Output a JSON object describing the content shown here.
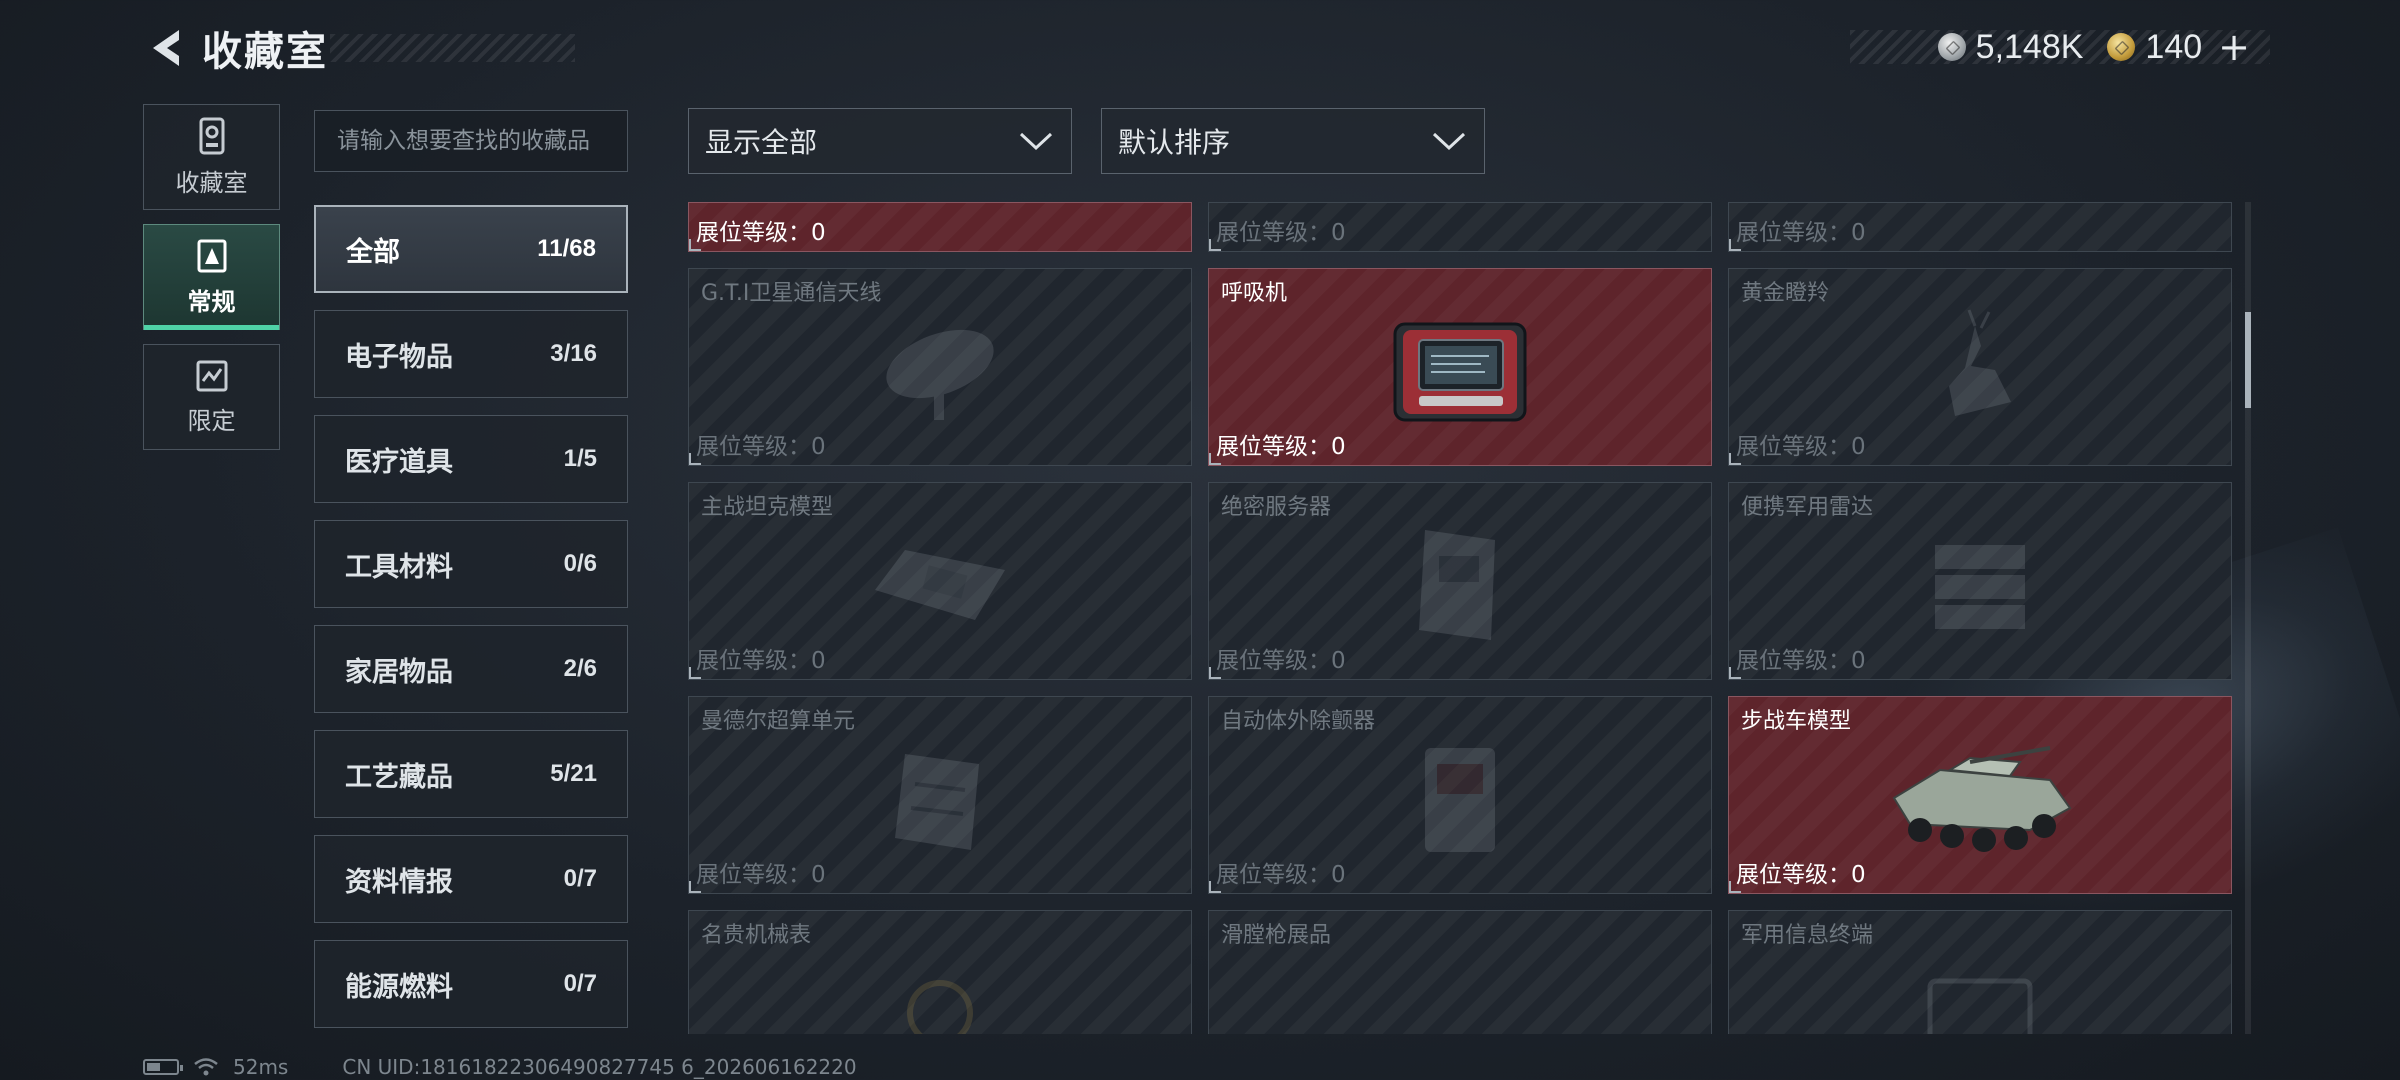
{
  "header": {
    "title": "收藏室",
    "currency": [
      {
        "icon": "silver-coin-icon",
        "value": "5,148K"
      },
      {
        "icon": "gold-coin-icon",
        "value": "140"
      }
    ],
    "plus_label": "+"
  },
  "mode_nav": [
    {
      "label": "收藏室",
      "icon": "collection-room-icon",
      "active": false
    },
    {
      "label": "常规",
      "icon": "regular-icon",
      "active": true
    },
    {
      "label": "限定",
      "icon": "limited-icon",
      "active": false
    }
  ],
  "search": {
    "placeholder": "请输入想要查找的收藏品"
  },
  "categories": [
    {
      "label": "全部",
      "count": "11/68",
      "active": true
    },
    {
      "label": "电子物品",
      "count": "3/16"
    },
    {
      "label": "医疗道具",
      "count": "1/5"
    },
    {
      "label": "工具材料",
      "count": "0/6"
    },
    {
      "label": "家居物品",
      "count": "2/6"
    },
    {
      "label": "工艺藏品",
      "count": "5/21"
    },
    {
      "label": "资料情报",
      "count": "0/7"
    },
    {
      "label": "能源燃料",
      "count": "0/7"
    }
  ],
  "filters": {
    "show_label": "显示全部",
    "sort_label": "默认排序"
  },
  "items": [
    {
      "name": "",
      "level": "展位等级：0",
      "owned": true,
      "icon": "item-icon"
    },
    {
      "name": "",
      "level": "展位等级：0",
      "owned": false,
      "icon": "item-icon"
    },
    {
      "name": "",
      "level": "展位等级：0",
      "owned": false,
      "icon": "item-icon"
    },
    {
      "name": "G.T.I卫星通信天线",
      "level": "展位等级：0",
      "owned": false,
      "icon": "satellite-dish-icon"
    },
    {
      "name": "呼吸机",
      "level": "展位等级：0",
      "owned": true,
      "icon": "ventilator-icon"
    },
    {
      "name": "黄金瞪羚",
      "level": "展位等级：0",
      "owned": false,
      "icon": "gazelle-statue-icon"
    },
    {
      "name": "主战坦克模型",
      "level": "展位等级：0",
      "owned": false,
      "icon": "tank-model-icon"
    },
    {
      "name": "绝密服务器",
      "level": "展位等级：0",
      "owned": false,
      "icon": "server-icon"
    },
    {
      "name": "便携军用雷达",
      "level": "展位等级：0",
      "owned": false,
      "icon": "radar-icon"
    },
    {
      "name": "曼德尔超算单元",
      "level": "展位等级：0",
      "owned": false,
      "icon": "supercomputer-unit-icon"
    },
    {
      "name": "自动体外除颤器",
      "level": "展位等级：0",
      "owned": false,
      "icon": "defibrillator-icon"
    },
    {
      "name": "步战车模型",
      "level": "展位等级：0",
      "owned": true,
      "icon": "ifv-model-icon"
    },
    {
      "name": "名贵机械表",
      "level": "",
      "owned": false,
      "icon": "watch-icon"
    },
    {
      "name": "滑膛枪展品",
      "level": "",
      "owned": false,
      "icon": "musket-icon"
    },
    {
      "name": "军用信息终端",
      "level": "",
      "owned": false,
      "icon": "terminal-icon"
    }
  ],
  "status_bar": {
    "ping": "52ms",
    "uid": "CN UID:18161822306490827745 6_202606162220",
    "battery_level": 0.45
  },
  "colors": {
    "owned_card": "#5e242b",
    "accent_green": "#4fd3a6"
  }
}
